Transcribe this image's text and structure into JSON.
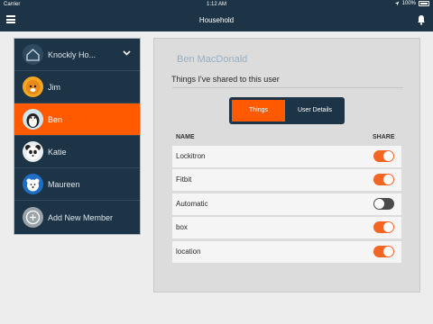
{
  "status_bar": {
    "carrier": "Carrier",
    "time": "1:12 AM",
    "battery": "100%"
  },
  "nav": {
    "title": "Household"
  },
  "sidebar": {
    "household": "Knockly Ho...",
    "members": [
      {
        "name": "Jim",
        "avatar": "tiger-avatar",
        "active": false
      },
      {
        "name": "Ben",
        "avatar": "penguin-avatar",
        "active": true
      },
      {
        "name": "Katie",
        "avatar": "panda-avatar",
        "active": false
      },
      {
        "name": "Maureen",
        "avatar": "polar-bear-avatar",
        "active": false
      }
    ],
    "add_member": "Add New Member"
  },
  "panel": {
    "user_name": "Ben MacDonald",
    "subtitle": "Things I've shared to this user",
    "tabs": [
      {
        "label": "Things",
        "selected": true
      },
      {
        "label": "User Details",
        "selected": false
      }
    ],
    "columns": {
      "name": "NAME",
      "share": "SHARE"
    },
    "items": [
      {
        "name": "Lockitron",
        "shared": true
      },
      {
        "name": "Fitbit",
        "shared": true
      },
      {
        "name": "Automatic",
        "shared": false
      },
      {
        "name": "box",
        "shared": true
      },
      {
        "name": "location",
        "shared": true
      }
    ]
  },
  "colors": {
    "accent": "#ff5a00",
    "nav": "#1d3447",
    "toggle_on": "#f26522",
    "toggle_off": "#4a4a4a"
  }
}
